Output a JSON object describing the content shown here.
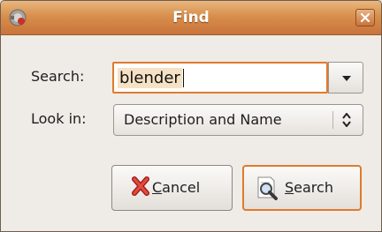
{
  "window": {
    "title": "Find",
    "app_icon": "app-icon",
    "close_icon": "close-icon"
  },
  "search": {
    "label": "Search:",
    "value": "blender",
    "dropdown_icon": "chevron-down-icon"
  },
  "look_in": {
    "label": "Look in:",
    "selected": "Description and Name",
    "icon": "updown-arrows-icon"
  },
  "buttons": {
    "cancel_label": "Cancel",
    "cancel_icon": "cancel-x-icon",
    "search_label": "Search",
    "search_icon": "search-magnifier-icon"
  },
  "colors": {
    "titlebar": "#d88f4c",
    "focus": "#e07a2e",
    "background": "#efebe7"
  }
}
